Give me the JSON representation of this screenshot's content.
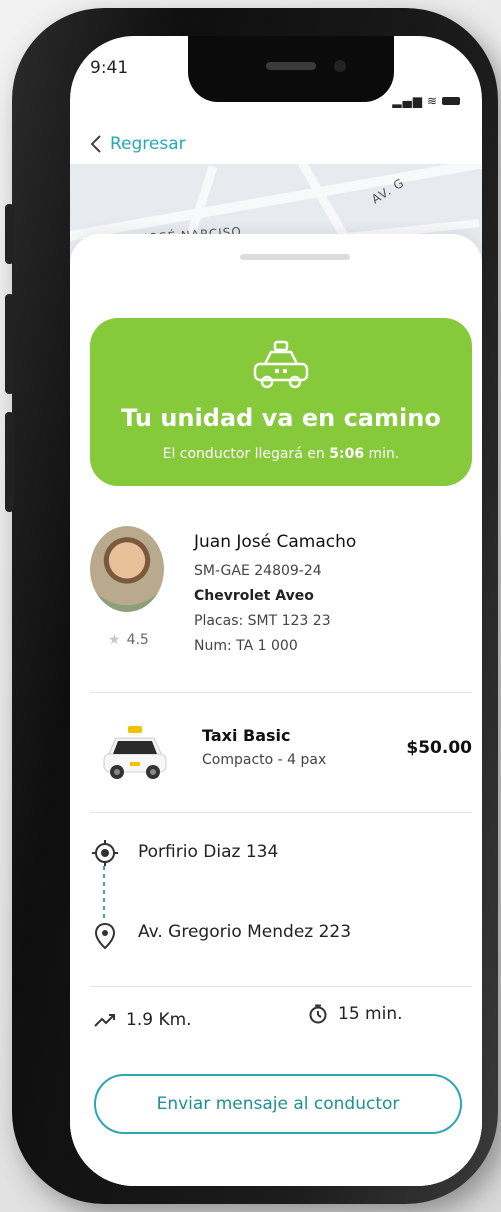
{
  "status_bar": {
    "time": "9:41"
  },
  "nav": {
    "back_label": "Regresar"
  },
  "map": {
    "labels": [
      "JOSÉ NARCISO",
      "AV. G"
    ]
  },
  "banner": {
    "title": "Tu unidad va en camino",
    "subtitle_prefix": "El conductor llegará en",
    "eta": "5:06",
    "subtitle_suffix": "min.",
    "color": "#86c93b"
  },
  "driver": {
    "name": "Juan José Camacho",
    "plate_code": "SM-GAE 24809-24",
    "car_model": "Chevrolet Aveo",
    "placas": "Placas: SMT 123 23",
    "num": "Num: TA 1 000",
    "rating": "4.5"
  },
  "ride": {
    "name": "Taxi Basic",
    "description": "Compacto - 4 pax",
    "price": "$50.00"
  },
  "route": {
    "origin": "Porfirio Diaz 134",
    "destination": "Av. Gregorio Mendez 223"
  },
  "metrics": {
    "distance": "1.9 Km.",
    "duration": "15 min."
  },
  "cta": {
    "label": "Enviar mensaje al conductor",
    "accent": "#2aa8b1"
  }
}
